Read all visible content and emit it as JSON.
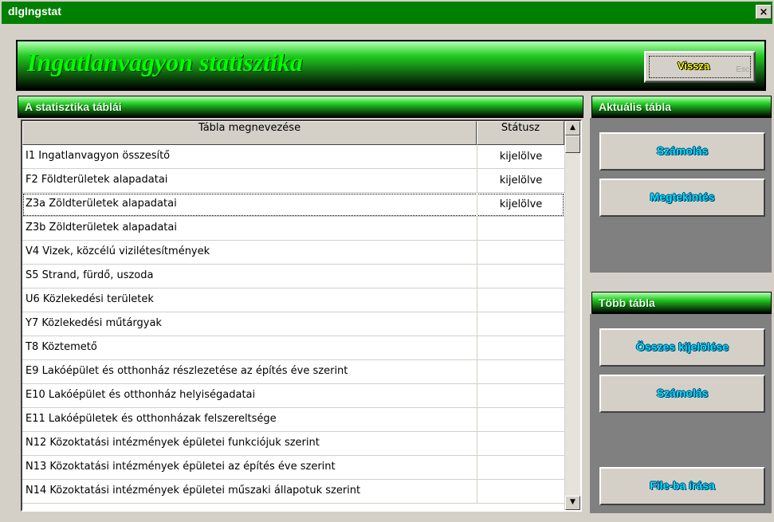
{
  "window": {
    "title": "dlgIngstat",
    "close_glyph": "×"
  },
  "header": {
    "title": "Ingatlanvagyon statisztika"
  },
  "back_button": {
    "label": "Vissza",
    "shortcut": "Esc"
  },
  "tables_section": {
    "title": "A statisztika táblái",
    "columns": [
      "Tábla megnevezése",
      "Státusz"
    ],
    "rows": [
      {
        "name": "I1 Ingatlanvagyon összesítő",
        "status": "kijelölve"
      },
      {
        "name": "F2 Földterületek alapadatai",
        "status": "kijelölve"
      },
      {
        "name": "Z3a Zöldterületek alapadatai",
        "status": "kijelölve"
      },
      {
        "name": "Z3b Zöldterületek alapadatai",
        "status": ""
      },
      {
        "name": "V4 Vizek, közcélú vizilétesítmények",
        "status": ""
      },
      {
        "name": "S5 Strand, fürdő, uszoda",
        "status": ""
      },
      {
        "name": "U6 Közlekedési területek",
        "status": ""
      },
      {
        "name": "Y7 Közlekedési műtárgyak",
        "status": ""
      },
      {
        "name": "T8 Köztemető",
        "status": ""
      },
      {
        "name": "E9 Lakóépület és otthonház részlezetése az építés éve szerint",
        "status": ""
      },
      {
        "name": "E10 Lakóépület és otthonház helyiségadatai",
        "status": ""
      },
      {
        "name": "E11 Lakóépületek és otthonházak felszereltsége",
        "status": ""
      },
      {
        "name": "N12 Közoktatási intézmények épületei funkciójuk szerint",
        "status": ""
      },
      {
        "name": "N13 Közoktatási intézmények épületei az építés éve szerint",
        "status": ""
      },
      {
        "name": "N14 Közoktatási intézmények épületei műszaki állapotuk szerint",
        "status": ""
      }
    ],
    "scroll": {
      "up_glyph": "▲",
      "down_glyph": "▼"
    }
  },
  "current_table": {
    "title": "Aktuális tábla",
    "calc_label": "Számolás",
    "view_label": "Megtekintés"
  },
  "multiple_tables": {
    "title": "Több tábla",
    "select_all_label": "Összes kijelölése",
    "calc_label": "Számolás",
    "write_file_label": "File-ba írása"
  },
  "colors": {
    "title_bar": "#008000",
    "banner_text": "#00ff00",
    "button_text": "#00e5ff",
    "back_text": "#ffff00"
  }
}
